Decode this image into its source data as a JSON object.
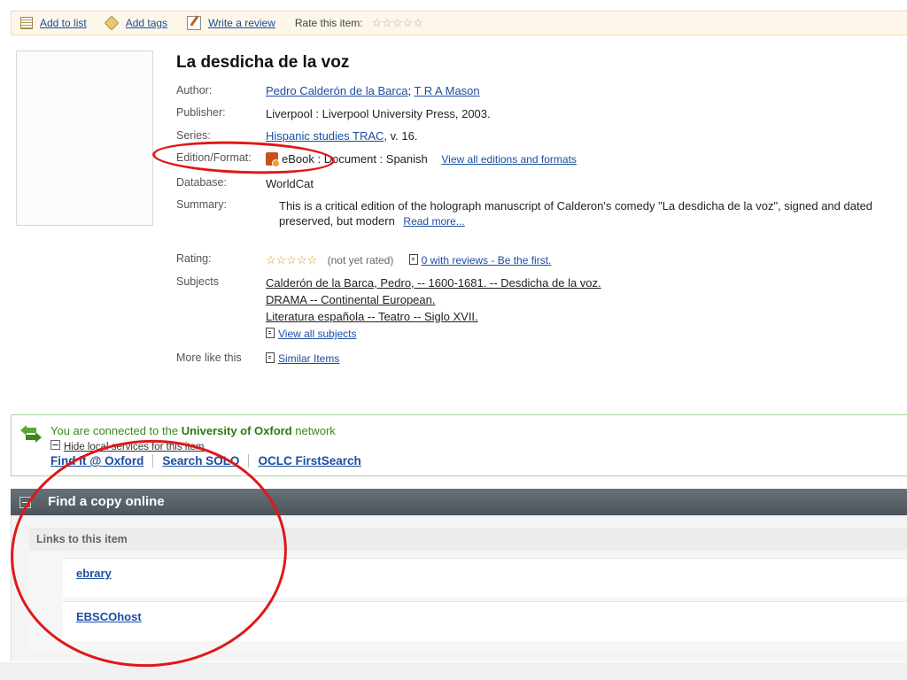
{
  "toolbar": {
    "add_to_list": "Add to list",
    "add_tags": "Add tags",
    "write_review": "Write a review",
    "rate_label": "Rate this item:",
    "rate_stars": "☆☆☆☆☆"
  },
  "record": {
    "title": "La desdicha de la voz",
    "labels": {
      "author": "Author:",
      "publisher": "Publisher:",
      "series": "Series:",
      "edition": "Edition/Format:",
      "database": "Database:",
      "summary": "Summary:",
      "rating": "Rating:",
      "subjects": "Subjects",
      "more_like": "More like this"
    },
    "authors": [
      "Pedro Calderón de la Barca",
      "T R A Mason"
    ],
    "author_sep": ";",
    "publisher": "Liverpool : Liverpool University Press, 2003.",
    "series_link": "Hispanic studies TRAC",
    "series_suffix": ", v. 16.",
    "edition_text": "eBook : Document : Spanish",
    "view_editions": "View all editions and formats",
    "database": "WorldCat",
    "summary_line1": "This is a critical edition of the holograph manuscript of Calderon's comedy \"La desdicha de la voz\", signed and dated",
    "summary_line2": "preserved, but modern",
    "read_more": "Read more...",
    "rating_stars": "☆☆☆☆☆",
    "rating_note": "(not yet rated)",
    "reviews_link": "0 with reviews - Be the first.",
    "subjects": [
      "Calderón de la Barca, Pedro, -- 1600-1681. -- Desdicha de la voz.",
      "DRAMA -- Continental European.",
      "Literatura española -- Teatro -- Siglo XVII."
    ],
    "view_all_subjects": "View all subjects",
    "similar_items": "Similar Items"
  },
  "connected": {
    "prefix": "You are connected to the ",
    "institution": "University of Oxford",
    "suffix": " network",
    "hide_link": "Hide local services for this item",
    "services": [
      "Find it @ Oxford",
      "Search SOLO",
      "OCLC FirstSearch"
    ]
  },
  "find_copy": {
    "title": "Find a copy online",
    "links_heading": "Links to this item",
    "links": [
      "ebrary",
      "EBSCOhost"
    ]
  },
  "colors": {
    "annotation_red": "#e01818",
    "link_blue": "#1a4ea0",
    "network_green": "#3a8a1a",
    "header_gray": "#5a6268"
  }
}
